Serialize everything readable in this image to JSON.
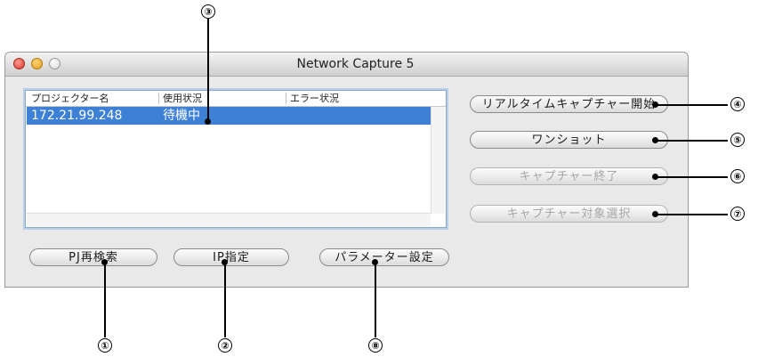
{
  "window": {
    "title": "Network Capture 5"
  },
  "table": {
    "headers": [
      "プロジェクター名",
      "使用状況",
      "エラー状況"
    ],
    "rows": [
      {
        "name": "172.21.99.248",
        "status": "待機中",
        "error": ""
      }
    ]
  },
  "buttons": {
    "realtime_capture_start": "リアルタイムキャプチャー開始",
    "one_shot": "ワンショット",
    "capture_end": "キャプチャー終了",
    "capture_target_select": "キャプチャー対象選択",
    "pj_research": "PJ再検索",
    "ip_specify": "IP指定",
    "parameter_settings": "パラメーター設定"
  },
  "callouts": [
    "①",
    "②",
    "③",
    "④",
    "⑤",
    "⑥",
    "⑦",
    "⑧"
  ],
  "colors": {
    "selection": "#3d80d6",
    "close": "#d8352a",
    "minimize": "#e5a11a"
  }
}
